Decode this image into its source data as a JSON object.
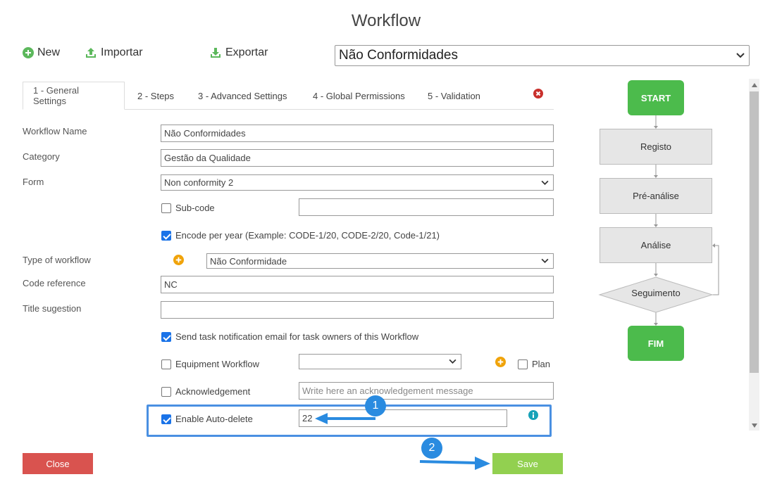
{
  "page": {
    "title": "Workflow"
  },
  "toolbar": {
    "new_label": "New",
    "import_label": "Importar",
    "export_label": "Exportar",
    "workflow_selected": "Não Conformidades"
  },
  "tabs": [
    {
      "label": "1 - General Settings",
      "active": true
    },
    {
      "label": "2 - Steps"
    },
    {
      "label": "3 - Advanced Settings"
    },
    {
      "label": "4 - Global Permissions"
    },
    {
      "label": "5 - Validation"
    }
  ],
  "form": {
    "workflow_name": {
      "label": "Workflow Name",
      "value": "Não Conformidades"
    },
    "category": {
      "label": "Category",
      "value": "Gestão da Qualidade"
    },
    "form": {
      "label": "Form",
      "value": "Non conformity 2"
    },
    "subcode": {
      "label": "Sub-code",
      "checked": false,
      "value": ""
    },
    "encode_per_year": {
      "label": "Encode per year (Example: CODE-1/20, CODE-2/20, Code-1/21)",
      "checked": true
    },
    "type_of_workflow": {
      "label": "Type of workflow",
      "value": "Não Conformidade"
    },
    "code_reference": {
      "label": "Code reference",
      "value": "NC"
    },
    "title_suggestion": {
      "label": "Title sugestion",
      "value": ""
    },
    "send_notification": {
      "label": "Send task notification email for task owners of this Workflow",
      "checked": true
    },
    "equipment_workflow": {
      "label": "Equipment Workflow",
      "checked": false,
      "value": ""
    },
    "plan": {
      "label": "Plan",
      "checked": false
    },
    "acknowledgement": {
      "label": "Acknowledgement",
      "checked": false,
      "placeholder": "Write here an acknowledgement message"
    },
    "auto_delete": {
      "label": "Enable Auto-delete",
      "checked": true,
      "value": "22"
    }
  },
  "annotations": {
    "badge1": "1",
    "badge2": "2"
  },
  "footer": {
    "close_label": "Close",
    "save_label": "Save"
  },
  "flowchart": {
    "start": "START",
    "step1": "Registo",
    "step2": "Pré-análise",
    "step3": "Análise",
    "decision": "Seguimento",
    "end": "FIM"
  },
  "colors": {
    "accent_blue": "#1a73e8",
    "highlight_blue": "#4a90e2",
    "close_red": "#d9534f",
    "save_green": "#92d050",
    "node_green": "#4cbb4c",
    "plus_orange": "#f0a30a"
  }
}
